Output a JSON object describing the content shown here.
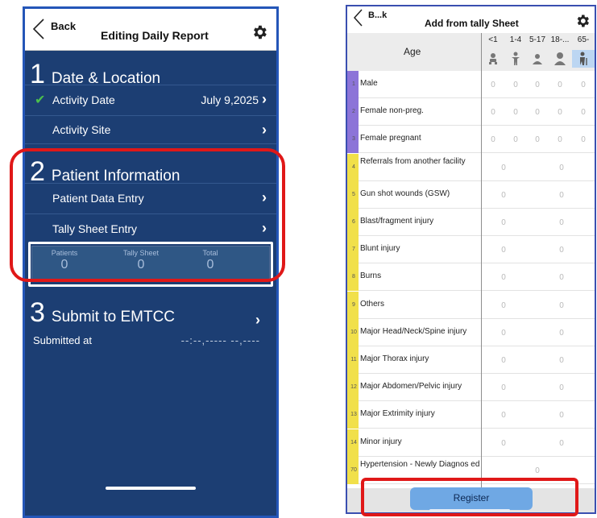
{
  "left_screen": {
    "header": {
      "back_label": "Back",
      "title": "Editing Daily Report"
    },
    "section1": {
      "number": "1",
      "title": "Date & Location",
      "activity_date_label": "Activity Date",
      "activity_date_value": "July 9,2025",
      "activity_site_label": "Activity Site"
    },
    "section2": {
      "number": "2",
      "title": "Patient Information",
      "patient_entry_label": "Patient Data Entry",
      "tally_entry_label": "Tally Sheet Entry",
      "stats": [
        {
          "label": "Patients",
          "value": "0"
        },
        {
          "label": "Tally Sheet",
          "value": "0"
        },
        {
          "label": "Total",
          "value": "0"
        }
      ]
    },
    "section3": {
      "number": "3",
      "title": "Submit to EMTCC",
      "submitted_label": "Submitted at",
      "submitted_value": "--:--,----- --,----"
    },
    "chevron": "›"
  },
  "right_screen": {
    "header": {
      "back_label": "B...k",
      "title": "Add from tally Sheet"
    },
    "age_label": "Age",
    "age_columns": [
      {
        "label": "<1",
        "icon": "infant-icon"
      },
      {
        "label": "1-4",
        "icon": "child-icon"
      },
      {
        "label": "5-17",
        "icon": "youth-icon"
      },
      {
        "label": "18-...",
        "icon": "adult-icon"
      },
      {
        "label": "65-",
        "icon": "elderly-icon"
      }
    ],
    "rows": [
      {
        "num": "1",
        "label": "Male",
        "values": [
          "0",
          "0",
          "0",
          "0",
          "0"
        ],
        "bar_color": "#8c74d8"
      },
      {
        "num": "2",
        "label": "Female non-preg.",
        "values": [
          "0",
          "0",
          "0",
          "0",
          "0"
        ],
        "bar_color": "#8c74d8"
      },
      {
        "num": "3",
        "label": "Female pregnant",
        "values": [
          "0",
          "0",
          "0",
          "0",
          "0"
        ],
        "bar_color": "#8c74d8"
      },
      {
        "num": "4",
        "label": "Referrals from another facility",
        "values": [
          "0",
          "0"
        ],
        "bar_color": "#f1e04a"
      },
      {
        "num": "5",
        "label": "Gun shot wounds (GSW)",
        "values": [
          "0",
          "0"
        ],
        "bar_color": "#f1e04a"
      },
      {
        "num": "6",
        "label": "Blast/fragment injury",
        "values": [
          "0",
          "0"
        ],
        "bar_color": "#f1e04a"
      },
      {
        "num": "7",
        "label": "Blunt injury",
        "values": [
          "0",
          "0"
        ],
        "bar_color": "#f1e04a"
      },
      {
        "num": "8",
        "label": "Burns",
        "values": [
          "0",
          "0"
        ],
        "bar_color": "#f1e04a"
      },
      {
        "num": "9",
        "label": "Others",
        "values": [
          "0",
          "0"
        ],
        "bar_color": "#f1e04a"
      },
      {
        "num": "10",
        "label": "Major Head/Neck/Spine injury",
        "values": [
          "0",
          "0"
        ],
        "bar_color": "#f1e04a"
      },
      {
        "num": "11",
        "label": "Major Thorax injury",
        "values": [
          "0",
          "0"
        ],
        "bar_color": "#f1e04a"
      },
      {
        "num": "12",
        "label": "Major Abdomen/Pelvic injury",
        "values": [
          "0",
          "0"
        ],
        "bar_color": "#f1e04a"
      },
      {
        "num": "13",
        "label": "Major Extrimity injury",
        "values": [
          "0",
          "0"
        ],
        "bar_color": "#f1e04a"
      },
      {
        "num": "14",
        "label": "Minor injury",
        "values": [
          "0",
          "0"
        ],
        "bar_color": "#f1e04a"
      },
      {
        "num": "70",
        "label": "Hypertension - Newly Diagnos ed",
        "values": [
          "0"
        ],
        "bar_color": "#f1e04a"
      }
    ],
    "register_label": "Register"
  },
  "colors": {
    "left_bg": "#1c3e73",
    "highlight_red": "#e01818",
    "register_blue": "#6fa8e4"
  }
}
